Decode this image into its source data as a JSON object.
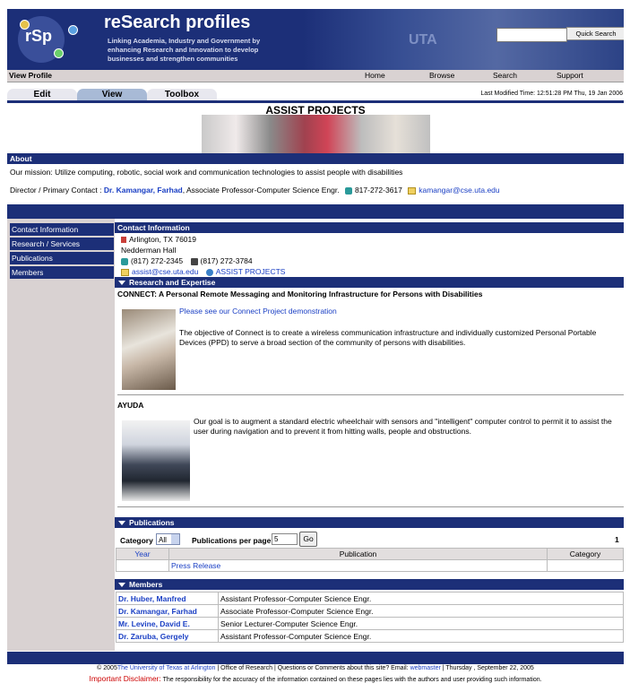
{
  "header": {
    "app_title": "reSearch profiles",
    "logo_text": "rSp",
    "tagline": "Linking Academia, Industry and Government by enhancing Research and Innovation to develop businesses and strengthen communities",
    "uta_mark": "UTA",
    "search_value": "",
    "quick_search_label": "Quick Search"
  },
  "nav": {
    "view_profile": "View Profile",
    "links": [
      "Home",
      "Browse",
      "Search",
      "Support"
    ]
  },
  "tabs": {
    "items": [
      "Edit",
      "View",
      "Toolbox"
    ],
    "active": "View",
    "last_modified": "Last Modified Time: 12:51:28 PM Thu, 19 Jan 2006"
  },
  "project": {
    "title": "ASSIST PROJECTS"
  },
  "about": {
    "heading": "About",
    "mission": "Our mission: Utilize computing, robotic, social work and communication technologies to assist people with disabilities",
    "director_prefix": "Director / Primary Contact :",
    "director_name": "Dr. Kamangar, Farhad",
    "director_title": ", Associate Professor-Computer Science Engr.",
    "director_phone": "817-272-3617",
    "director_email": "kamangar@cse.uta.edu"
  },
  "sidebar": {
    "items": [
      "Contact Information",
      "Research / Services",
      "Publications",
      "Members"
    ]
  },
  "contact": {
    "heading": "Contact Information",
    "city": "Arlington, TX 76019",
    "building": "Nedderman Hall",
    "phone": "(817) 272-2345",
    "fax": "(817) 272-3784",
    "email": "assist@cse.uta.edu",
    "website": "ASSIST PROJECTS"
  },
  "research": {
    "heading": "Research and Expertise",
    "items": [
      {
        "title": "CONNECT: A Personal Remote Messaging and Monitoring Infrastructure for Persons with Disabilities",
        "link": "Please see our Connect Project demonstration",
        "description": "The objective of Connect is to create a wireless communication infrastructure and individually customized Personal Portable Devices (PPD) to serve a broad section of the community of persons with disabilities."
      },
      {
        "title": "AYUDA",
        "description": "Our goal is to augment a standard electric wheelchair with sensors and \"intelligent\" computer control to permit it to assist the user during navigation and to prevent it from hitting walls, people and obstructions."
      }
    ]
  },
  "publications": {
    "heading": "Publications",
    "category_label": "Category",
    "category_value": "All",
    "per_page_label": "Publications per page",
    "per_page_value": "5",
    "go_label": "Go",
    "page_number": "1",
    "columns": [
      "Year",
      "Publication",
      "Category"
    ],
    "rows": [
      {
        "year": "",
        "publication": "Press Release",
        "category": ""
      }
    ]
  },
  "members": {
    "heading": "Members",
    "rows": [
      {
        "name": "Dr. Huber, Manfred",
        "title": "Assistant Professor-Computer Science Engr."
      },
      {
        "name": "Dr. Kamangar, Farhad",
        "title": "Associate Professor-Computer Science Engr."
      },
      {
        "name": "Mr. Levine, David E.",
        "title": "Senior Lecturer-Computer Science Engr."
      },
      {
        "name": "Dr. Zaruba, Gergely",
        "title": "Assistant Professor-Computer Science Engr."
      }
    ]
  },
  "footer": {
    "copyright": "© 2005",
    "university": "The University of Texas at Arlington",
    "mid": " | Office of Research | Questions or Comments about this site? Email: ",
    "webmaster": "webmaster",
    "date": " | Thursday , September 22, 2005",
    "disclaimer_label": "Important Disclaimer:",
    "disclaimer_text": " The responsibility for the accuracy of the information contained on these pages lies with the authors and user providing such information."
  },
  "colors": {
    "navy": "#1c2f78",
    "link": "#1a3fc4",
    "sidebar": "#d9d2d2",
    "disclaimer": "#cc0000"
  }
}
